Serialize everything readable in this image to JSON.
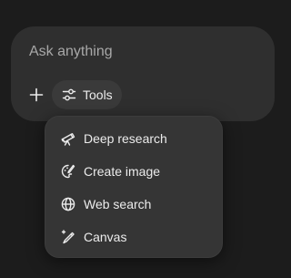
{
  "composer": {
    "placeholder": "Ask anything",
    "tools_label": "Tools"
  },
  "menu": {
    "items": [
      {
        "label": "Deep research",
        "icon": "telescope-icon"
      },
      {
        "label": "Create image",
        "icon": "palette-icon"
      },
      {
        "label": "Web search",
        "icon": "globe-icon"
      },
      {
        "label": "Canvas",
        "icon": "pen-sparkle-icon"
      }
    ]
  },
  "colors": {
    "background": "#1c1c1c",
    "composer": "#2f2f2f",
    "menu": "#353535",
    "text": "#ececec",
    "placeholder": "#a8a8a8"
  }
}
